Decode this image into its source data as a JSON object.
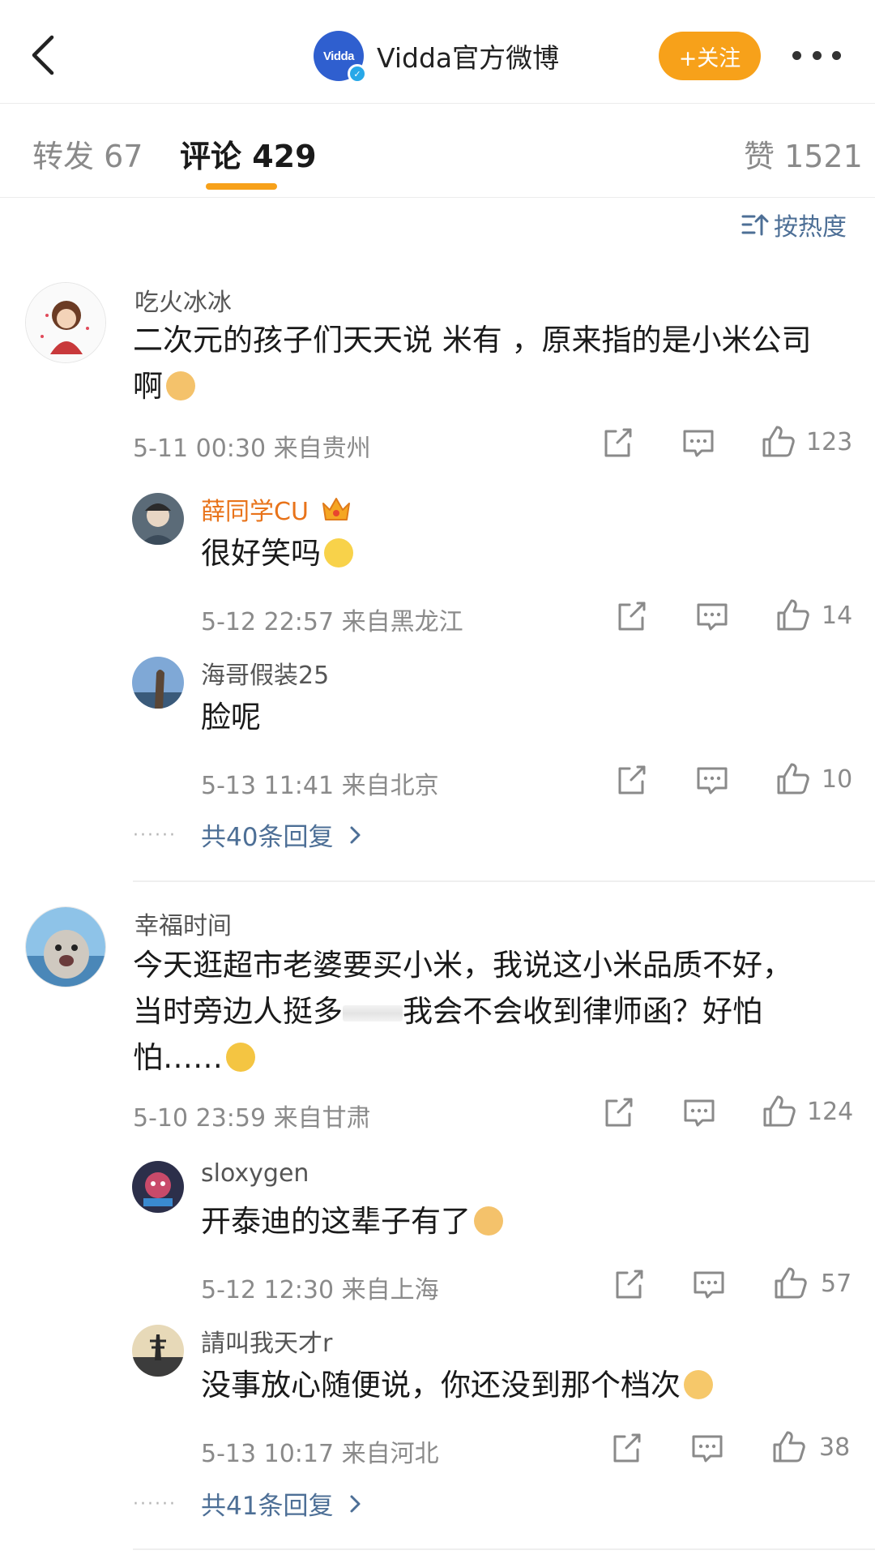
{
  "header": {
    "account_name": "Vidda官方微博",
    "logo_text": "Vidda",
    "follow_label": "+关注"
  },
  "tabs": [
    {
      "label": "转发 67"
    },
    {
      "label": "评论 429"
    },
    {
      "label": "赞 1521"
    }
  ],
  "sort_label": "按热度",
  "comments": [
    {
      "user": "吃火冰冰",
      "text_line1": "二次元的孩子们天天说 米有 ，原来指的是小米公司",
      "text_line2": "啊",
      "meta": "5-11 00:30  来自贵州",
      "likes": "123",
      "replies": [
        {
          "user": "薛同学CU",
          "text": "很好笑吗",
          "meta": "5-12 22:57  来自黑龙江",
          "likes": "14"
        },
        {
          "user": "海哥假装25",
          "text": "脸呢",
          "meta": "5-13 11:41  来自北京",
          "likes": "10"
        }
      ],
      "more_replies": "共40条回复",
      "dots": "······"
    },
    {
      "user": "幸福时间",
      "text_line1": "今天逛超市老婆要买小米，我说这小米品质不好，",
      "text_line2a": "当时旁边人挺多",
      "text_line2b": "我会不会收到律师函？好怕",
      "text_line3": "怕……",
      "meta": "5-10 23:59  来自甘肃",
      "likes": "124",
      "replies": [
        {
          "user": "sloxygen",
          "text": "开泰迪的这辈子有了",
          "meta": "5-12 12:30  来自上海",
          "likes": "57"
        },
        {
          "user": "請叫我天才r",
          "text": "没事放心随便说，你还没到那个档次",
          "meta": "5-13 10:17  来自河北",
          "likes": "38"
        }
      ],
      "more_replies": "共41条回复",
      "dots": "······"
    }
  ],
  "colors": {
    "accent": "#f7a11a",
    "link": "#4d6f96",
    "vip_name": "#e8731a"
  }
}
